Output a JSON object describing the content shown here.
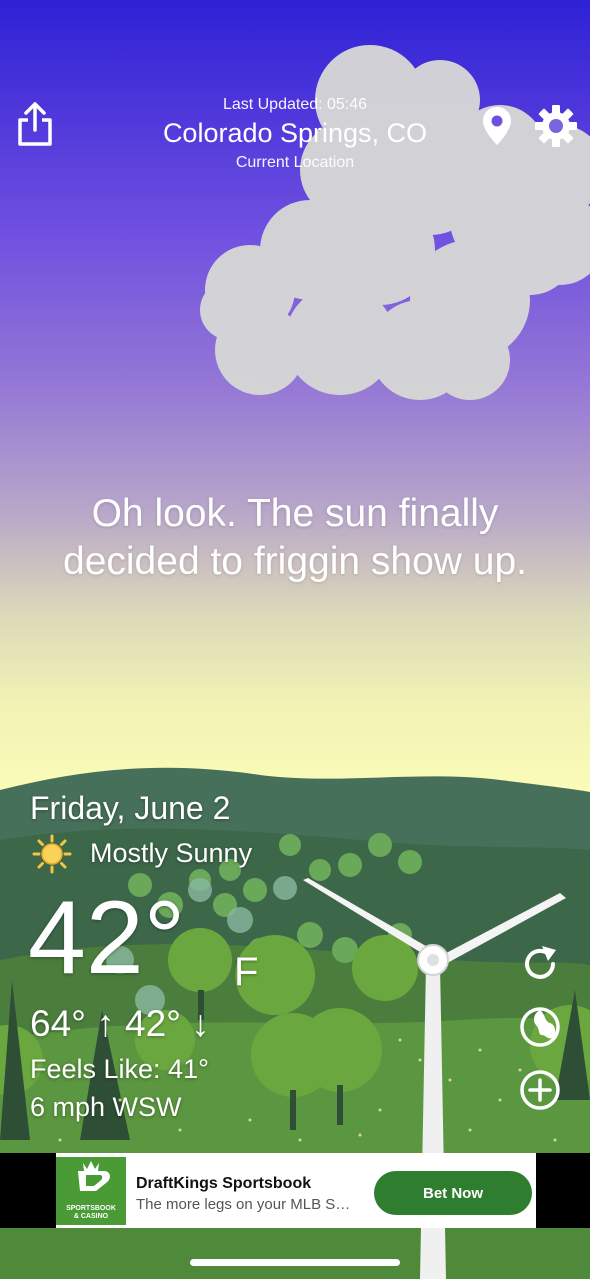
{
  "header": {
    "last_updated": "Last Updated: 05:46",
    "city": "Colorado Springs, CO",
    "location_label": "Current Location"
  },
  "message": "Oh look. The sun finally decided to friggin show up.",
  "weather": {
    "date": "Friday, June 2",
    "condition": "Mostly Sunny",
    "temperature": "42°",
    "unit": "F",
    "high_low": "64° ↑ 42° ↓",
    "feels_like": "Feels Like: 41°",
    "wind": "6 mph WSW"
  },
  "icons": {
    "share": "share-icon",
    "location": "location-pin-icon",
    "settings": "gear-icon",
    "condition": "sun-icon",
    "refresh": "refresh-icon",
    "radar": "radar-icon",
    "add": "add-icon"
  },
  "ad": {
    "logo_line1": "SPORTSBOOK",
    "logo_line2": "& CASINO",
    "title": "DraftKings Sportsbook",
    "subtitle": "The more legs on your MLB S…",
    "button": "Bet Now"
  },
  "colors": {
    "sky_top": "#2e21d6",
    "sky_bottom": "#fbfcb8",
    "hills": "#3f6a50",
    "grass": "#5f9640",
    "ad_button": "#2f7d2e",
    "ad_logo": "#4a9b35"
  }
}
